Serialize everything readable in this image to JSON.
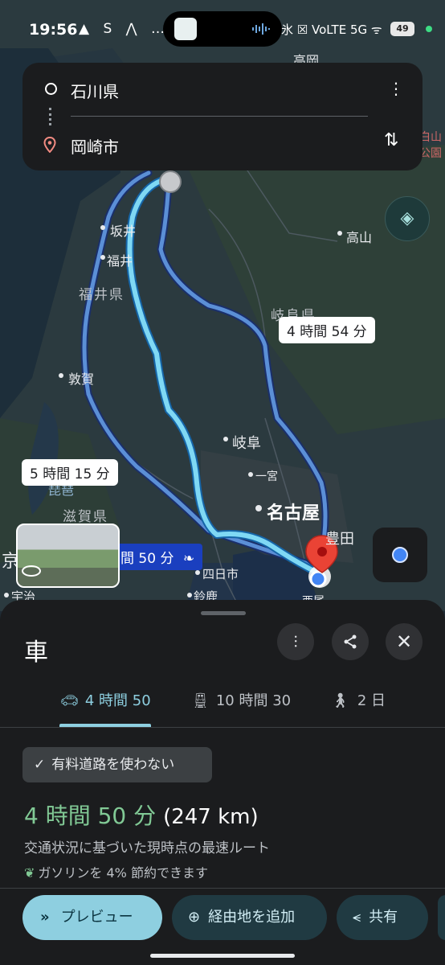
{
  "status_bar": {
    "time": "19:56",
    "left_icons": "▲ S ⋀ …",
    "right_icons": "氷 ☒ VoLTE 5G ᯤ",
    "battery": "49"
  },
  "route": {
    "origin": "石川県",
    "destination": "岡崎市"
  },
  "map": {
    "labels": {
      "takaoka": "高岡",
      "sakai": "坂井",
      "fukui": "福井",
      "fukui_pref": "福井県",
      "takayama": "高山",
      "gifu_pref": "岐阜県",
      "tsuruga": "敦賀",
      "gifu": "岐阜",
      "ichinomiya": "一宮",
      "biwa": "琵琶",
      "shiga_pref": "滋賀県",
      "nagoya": "名古屋",
      "toyota": "豊田",
      "kyo": "京",
      "yokkaichi": "四日市",
      "uji": "宇治",
      "suzuka": "鈴鹿",
      "nishio": "西尾",
      "park": "白山\n公園"
    },
    "bubble_alt1": "4 時間 54 分",
    "bubble_alt2": "5 時間 15 分",
    "bubble_main": "間 50 分"
  },
  "sheet": {
    "title": "車",
    "tabs": [
      {
        "icon": "car-icon",
        "label": "4 時間 50"
      },
      {
        "icon": "train-icon",
        "label": "10 時間 30"
      },
      {
        "icon": "walk-icon",
        "label": "2 日"
      }
    ],
    "chip_label": "有料道路を使わない",
    "duration": "4 時間 50 分",
    "distance": "(247 km)",
    "subtext": "交通状況に基づいた現時点の最速ルート",
    "eco_text": "ガソリンを 4% 節約できます",
    "actions": {
      "preview": "プレビュー",
      "add_stop": "経由地を追加",
      "share": "共有"
    }
  },
  "colors": {
    "route_main": "#7fd8f4",
    "route_alt": "#5b8fd6",
    "accent": "#8ecfe0",
    "duration": "#81c995",
    "pin": "#ea4335"
  }
}
